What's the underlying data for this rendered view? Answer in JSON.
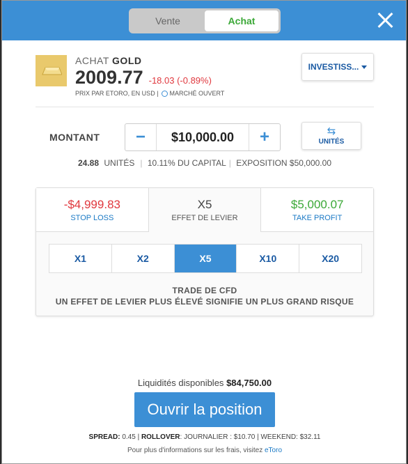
{
  "header": {
    "tabs": [
      {
        "label": "Vente",
        "active": false
      },
      {
        "label": "Achat",
        "active": true
      }
    ]
  },
  "asset": {
    "action": "ACHAT",
    "name": "GOLD",
    "price": "2009.77",
    "change": "-18.03 (-0.89%)",
    "price_source": "PRIX PAR ETORO, EN USD |",
    "market_status": "MARCHÉ OUVERT",
    "icon": "gold-bar-icon"
  },
  "invest_menu": {
    "label": "INVESTISS..."
  },
  "amount": {
    "label": "MONTANT",
    "value": "$10,000.00",
    "minus": "−",
    "plus": "+",
    "units_label": "UNITÉS"
  },
  "stats": {
    "units_value": "24.88",
    "units_label": "UNITÉS",
    "capital": "10.11% DU CAPITAL",
    "exposure": "EXPOSITION $50,000.00"
  },
  "risk_panel": {
    "stop_loss": {
      "value": "-$4,999.83",
      "label": "STOP LOSS"
    },
    "leverage": {
      "value": "X5",
      "label": "EFFET DE LEVIER"
    },
    "take_profit": {
      "value": "$5,000.07",
      "label": "TAKE PROFIT"
    },
    "leverage_options": [
      "X1",
      "X2",
      "X5",
      "X10",
      "X20"
    ],
    "selected_leverage": "X5",
    "warning_line1": "TRADE DE CFD",
    "warning_line2": "UN EFFET DE LEVIER PLUS ÉLEVÉ SIGNIFIE UN PLUS GRAND RISQUE"
  },
  "footer": {
    "liquidity_label": "Liquidités disponibles",
    "liquidity_value": "$84,750.00",
    "open_button": "Ouvrir la position",
    "spread_label": "SPREAD:",
    "spread_value": "0.45 |",
    "rollover_label": "ROLLOVER",
    "rollover_value": ": JOURNALIER : $10.70 | WEEKEND: $32.11",
    "info_text": "Pour plus d'informations sur les frais, visitez",
    "info_link": "eToro"
  },
  "colors": {
    "accent": "#3c8fd5",
    "buy_green": "#3ba837",
    "loss_red": "#e0383e",
    "gold": "#e9c96c"
  }
}
